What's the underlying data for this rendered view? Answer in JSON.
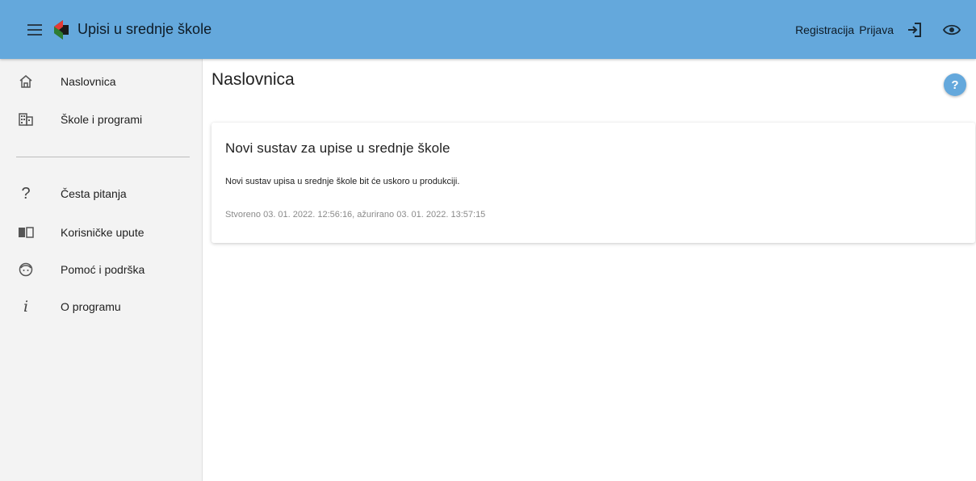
{
  "header": {
    "title": "Upisi u srednje škole",
    "registration_label": "Registracija",
    "login_label": "Prijava",
    "background_color": "#64a8dc",
    "icons": [
      "menu-icon",
      "logo",
      "login-icon",
      "eye-icon"
    ]
  },
  "sidebar": {
    "items": [
      {
        "label": "Naslovnica",
        "icon": "home-icon"
      },
      {
        "label": "Škole i programi",
        "icon": "building-icon"
      },
      {
        "label": "Česta pitanja",
        "icon": "question-icon"
      },
      {
        "label": "Korisničke upute",
        "icon": "book-icon"
      },
      {
        "label": "Pomoć i podrška",
        "icon": "support-icon"
      },
      {
        "label": "O programu",
        "icon": "info-icon"
      }
    ]
  },
  "main": {
    "page_title": "Naslovnica",
    "help_label": "?",
    "card": {
      "title": "Novi sustav za upise u srednje škole",
      "text": "Novi sustav upisa u srednje škole bit će uskoro u produkciji.",
      "meta": "Stvoreno 03. 01. 2022. 12:56:16, ažurirano 03. 01. 2022. 13:57:15"
    }
  }
}
